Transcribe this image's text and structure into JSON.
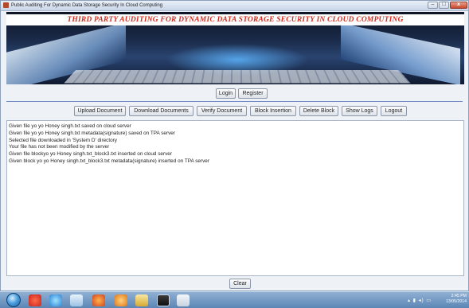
{
  "window": {
    "title": "Public Auditing For Dynamic Data Storage Security In Cloud Computing",
    "controls": {
      "minimize": "–",
      "maximize": "□",
      "close": "x"
    }
  },
  "banner": {
    "title": "THIRD PARTY AUDITING FOR DYNAMIC DATA STORAGE SECURITY IN CLOUD COMPUTING"
  },
  "auth": {
    "login": "Login",
    "register": "Register"
  },
  "toolbar": {
    "upload": "Upload Document",
    "download": "Download Documents",
    "verify": "Verify Document",
    "insert": "Block Insertion",
    "delete": "Delete Block",
    "logs": "Show Logs",
    "logout": "Logout"
  },
  "log": {
    "lines": [
      "Given file yo yo Honey singh.txt saved on cloud server",
      "Given file yo yo Honey singh.txt metadata(signature) saved on TPA server",
      "Selected file downloaded in 'System D' directory",
      "Your file has not been modified by the server",
      "Given file blockyo yo Honey singh.txt_block3.txt inserted on cloud server",
      "Given block yo yo Honey singh.txt_block3.txt metadata(signature) inserted on TPA server"
    ]
  },
  "clear_label": "Clear",
  "taskbar": {
    "time": "2:45 PM",
    "date": "13/05/2014",
    "tray_icons": "▴ ▮ ◂) ▭",
    "icons": [
      "windows-start-icon",
      "opera-icon",
      "ie-icon",
      "explorer-icon",
      "firefox-icon",
      "media-player-icon",
      "folder-icon",
      "terminal-icon",
      "java-icon"
    ]
  }
}
